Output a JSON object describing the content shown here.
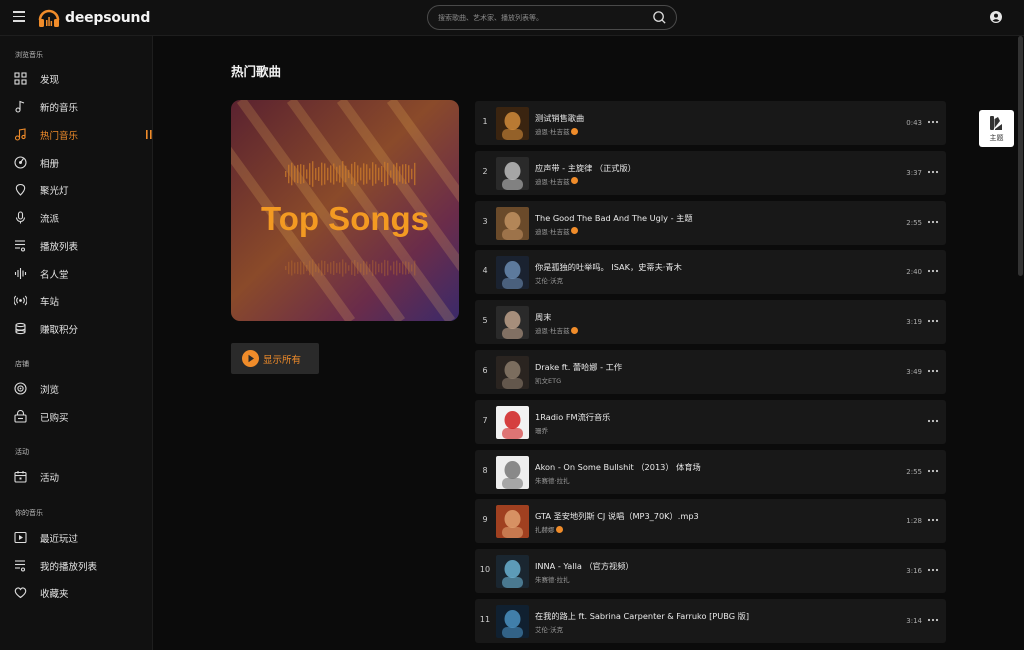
{
  "app": {
    "logo_text": "deepsound"
  },
  "search": {
    "placeholder": "搜索歌曲、艺术家、播放列表等。"
  },
  "sidebar": {
    "sections": [
      {
        "title": "浏览音乐"
      },
      {
        "title": "店铺"
      },
      {
        "title": "活动"
      },
      {
        "title": "你的音乐"
      }
    ],
    "items": [
      {
        "label": "发现",
        "icon": "grid-icon"
      },
      {
        "label": "新的音乐",
        "icon": "music-note-icon"
      },
      {
        "label": "热门音乐",
        "icon": "trending-note-icon",
        "active": true
      },
      {
        "label": "相册",
        "icon": "disc-icon"
      },
      {
        "label": "聚光灯",
        "icon": "spotlight-icon"
      },
      {
        "label": "流派",
        "icon": "microphone-icon"
      },
      {
        "label": "播放列表",
        "icon": "playlist-icon"
      },
      {
        "label": "名人堂",
        "icon": "equalizer-icon"
      },
      {
        "label": "车站",
        "icon": "radio-station-icon"
      },
      {
        "label": "赚取积分",
        "icon": "coins-icon"
      },
      {
        "label": "浏览",
        "icon": "browse-icon"
      },
      {
        "label": "已购买",
        "icon": "purchased-icon"
      },
      {
        "label": "活动",
        "icon": "calendar-icon"
      },
      {
        "label": "最近玩过",
        "icon": "recent-play-icon"
      },
      {
        "label": "我的播放列表",
        "icon": "playlist-icon"
      },
      {
        "label": "收藏夹",
        "icon": "heart-icon"
      }
    ]
  },
  "main": {
    "page_title": "热门歌曲",
    "cover_text": "Top Songs",
    "play_all_label": "显示所有"
  },
  "theme_button": {
    "label": "主题"
  },
  "colors": {
    "accent": "#f08c2a",
    "background": "#0b0b0b",
    "row": "#181818"
  },
  "tracks": [
    {
      "num": "1",
      "title": "测试销售歌曲",
      "artist": "迪恩·杜吉兹",
      "verified": true,
      "duration": "0:43"
    },
    {
      "num": "2",
      "title": "应声带 - 主旋律 （正式版）",
      "artist": "迪恩·杜吉兹",
      "verified": true,
      "duration": "3:37"
    },
    {
      "num": "3",
      "title": "The Good The Bad And The Ugly - 主题",
      "artist": "迪恩·杜吉兹",
      "verified": true,
      "duration": "2:55"
    },
    {
      "num": "4",
      "title": "你是孤独的吐举吗。 ISAK，史蒂夫·青木",
      "artist": "艾伦·沃克",
      "verified": false,
      "duration": "2:40"
    },
    {
      "num": "5",
      "title": "周末",
      "artist": "迪恩·杜吉兹",
      "verified": true,
      "duration": "3:19"
    },
    {
      "num": "6",
      "title": "Drake ft. 蕾哈娜 - 工作",
      "artist": "凯文ETG",
      "verified": false,
      "duration": "3:49"
    },
    {
      "num": "7",
      "title": "1Radio FM流行音乐",
      "artist": "珊乔",
      "verified": false,
      "duration": ""
    },
    {
      "num": "8",
      "title": "Akon - On Some Bullshit （2013） 体育场",
      "artist": "朱赛德·拉扎",
      "verified": false,
      "duration": "2:55"
    },
    {
      "num": "9",
      "title": "GTA 圣安地列斯 CJ 说唱（MP3_70K）.mp3",
      "artist": "扎赫娜",
      "verified": true,
      "duration": "1:28"
    },
    {
      "num": "10",
      "title": "INNA - Yalla （官方视频）",
      "artist": "朱赛德·拉扎",
      "verified": false,
      "duration": "3:16"
    },
    {
      "num": "11",
      "title": "在我的路上 ft. Sabrina Carpenter & Farruko [PUBG 版]",
      "artist": "艾伦·沃克",
      "verified": false,
      "duration": "3:14"
    }
  ]
}
